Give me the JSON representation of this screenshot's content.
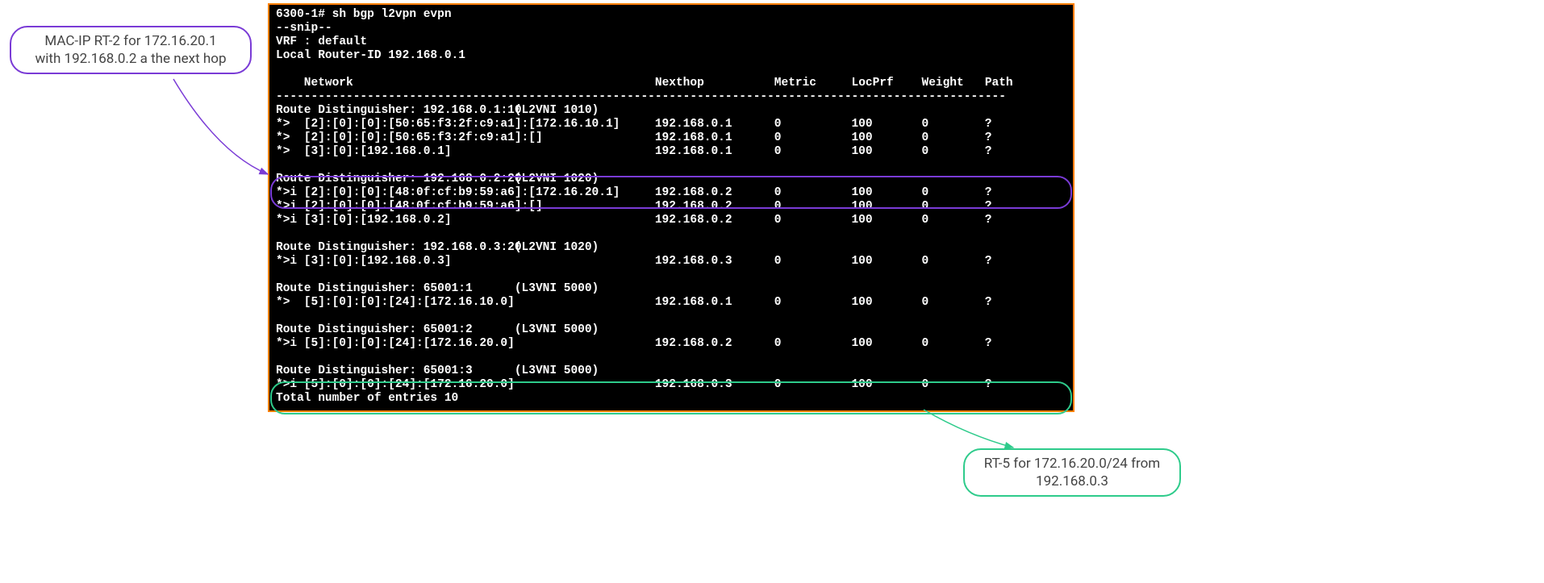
{
  "terminal": {
    "prompt": "6300-1# sh bgp l2vpn evpn",
    "snip": "--snip--",
    "vrf_line": "VRF : default",
    "router_id_line": "Local Router-ID 192.168.0.1",
    "headers": {
      "network": "Network",
      "nexthop": "Nexthop",
      "metric": "Metric",
      "locprf": "LocPrf",
      "weight": "Weight",
      "path": "Path"
    },
    "divider": "--------------------------------------------------------------------------------------------------------",
    "groups": [
      {
        "rd": "Route Distinguisher: 192.168.0.1:10",
        "note": "(L2VNI 1010)",
        "rows": [
          {
            "status": "*>",
            "net": "[2]:[0]:[0]:[50:65:f3:2f:c9:a1]:[172.16.10.1]",
            "nh": "192.168.0.1",
            "metric": "0",
            "locprf": "100",
            "weight": "0",
            "path": "?"
          },
          {
            "status": "*>",
            "net": "[2]:[0]:[0]:[50:65:f3:2f:c9:a1]:[]",
            "nh": "192.168.0.1",
            "metric": "0",
            "locprf": "100",
            "weight": "0",
            "path": "?"
          },
          {
            "status": "*>",
            "net": "[3]:[0]:[192.168.0.1]",
            "nh": "192.168.0.1",
            "metric": "0",
            "locprf": "100",
            "weight": "0",
            "path": "?"
          }
        ]
      },
      {
        "rd": "Route Distinguisher: 192.168.0.2:20",
        "note": "(L2VNI 1020)",
        "rows": [
          {
            "status": "*>i",
            "net": "[2]:[0]:[0]:[48:0f:cf:b9:59:a6]:[172.16.20.1]",
            "nh": "192.168.0.2",
            "metric": "0",
            "locprf": "100",
            "weight": "0",
            "path": "?"
          },
          {
            "status": "*>i",
            "net": "[2]:[0]:[0]:[48:0f:cf:b9:59:a6]:[]",
            "nh": "192.168.0.2",
            "metric": "0",
            "locprf": "100",
            "weight": "0",
            "path": "?"
          },
          {
            "status": "*>i",
            "net": "[3]:[0]:[192.168.0.2]",
            "nh": "192.168.0.2",
            "metric": "0",
            "locprf": "100",
            "weight": "0",
            "path": "?"
          }
        ]
      },
      {
        "rd": "Route Distinguisher: 192.168.0.3:20",
        "note": "(L2VNI 1020)",
        "rows": [
          {
            "status": "*>i",
            "net": "[3]:[0]:[192.168.0.3]",
            "nh": "192.168.0.3",
            "metric": "0",
            "locprf": "100",
            "weight": "0",
            "path": "?"
          }
        ]
      },
      {
        "rd": "Route Distinguisher: 65001:1",
        "note": "(L3VNI 5000)",
        "rows": [
          {
            "status": "*>",
            "net": "[5]:[0]:[0]:[24]:[172.16.10.0]",
            "nh": "192.168.0.1",
            "metric": "0",
            "locprf": "100",
            "weight": "0",
            "path": "?"
          }
        ]
      },
      {
        "rd": "Route Distinguisher: 65001:2",
        "note": "(L3VNI 5000)",
        "rows": [
          {
            "status": "*>i",
            "net": "[5]:[0]:[0]:[24]:[172.16.20.0]",
            "nh": "192.168.0.2",
            "metric": "0",
            "locprf": "100",
            "weight": "0",
            "path": "?"
          }
        ]
      },
      {
        "rd": "Route Distinguisher: 65001:3",
        "note": "(L3VNI 5000)",
        "rows": [
          {
            "status": "*>i",
            "net": "[5]:[0]:[0]:[24]:[172.16.20.0]",
            "nh": "192.168.0.3",
            "metric": "0",
            "locprf": "100",
            "weight": "0",
            "path": "?"
          }
        ]
      }
    ],
    "total": "Total number of entries 10"
  },
  "callouts": {
    "purple_line1": "MAC-IP RT-2 for 172.16.20.1",
    "purple_line2": "with 192.168.0.2 a the next hop",
    "green_line1": "RT-5 for 172.16.20.0/24 from",
    "green_line2": "192.168.0.3"
  }
}
